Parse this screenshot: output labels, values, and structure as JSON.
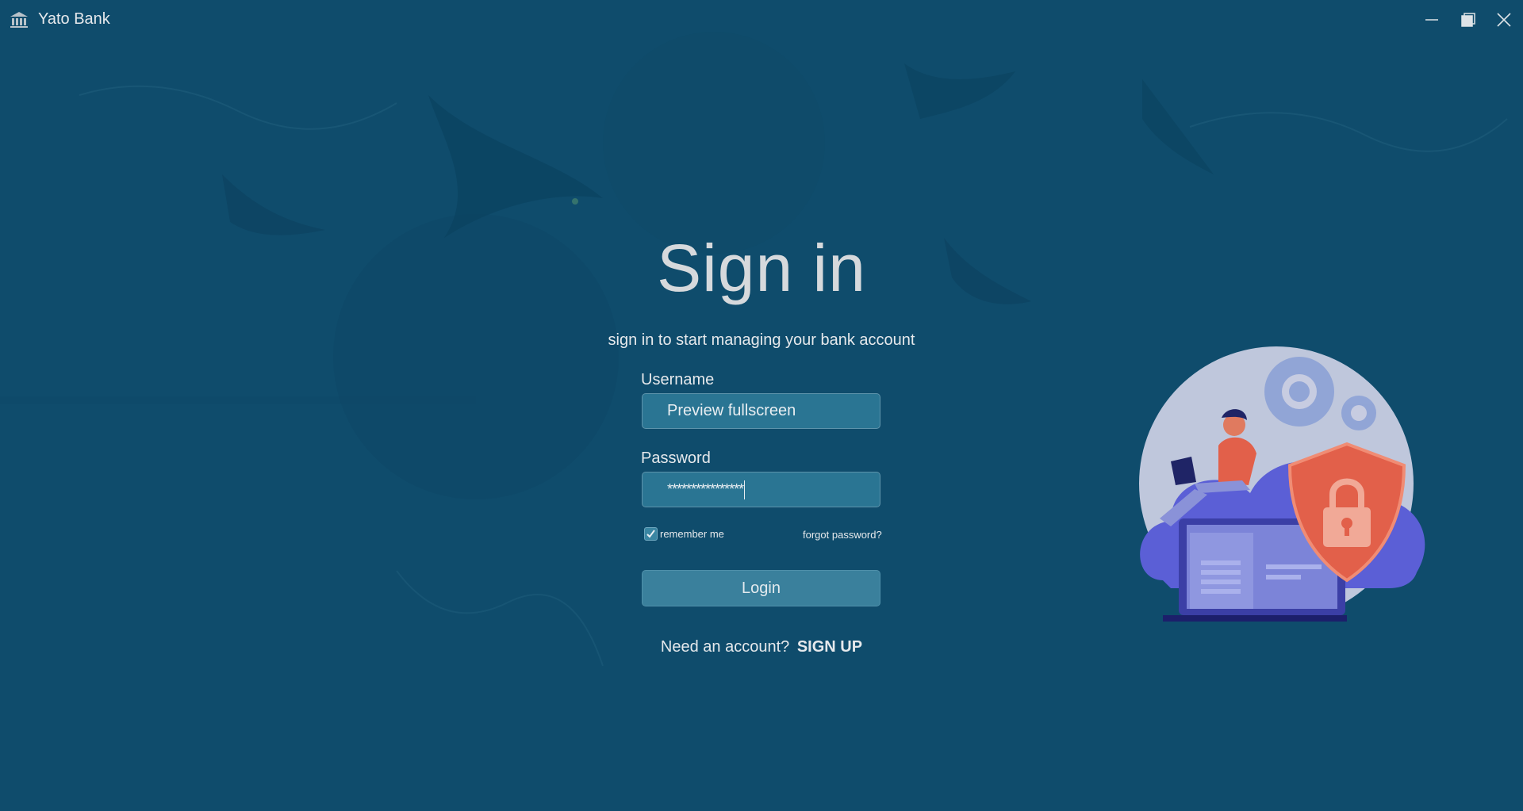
{
  "window": {
    "title": "Yato Bank",
    "icons": {
      "app": "bank-icon",
      "minimize": "minimize-icon",
      "maximize": "maximize-icon",
      "close": "close-icon"
    }
  },
  "signin": {
    "title": "Sign in",
    "subtitle": "sign in to start managing your bank account",
    "username_label": "Username",
    "username_value": "Preview fullscreen",
    "password_label": "Password",
    "password_value": "****************",
    "remember_label": "remember me",
    "remember_checked": true,
    "forgot_label": "forgot password?",
    "login_label": "Login",
    "signup_prompt": "Need an account?",
    "signup_label": "SIGN UP"
  },
  "colors": {
    "background": "#0f4c6c",
    "input_bg": "#2a7593",
    "button_bg": "#3a809c",
    "shield": "#e2604a",
    "cloud": "#5b5fd6"
  }
}
